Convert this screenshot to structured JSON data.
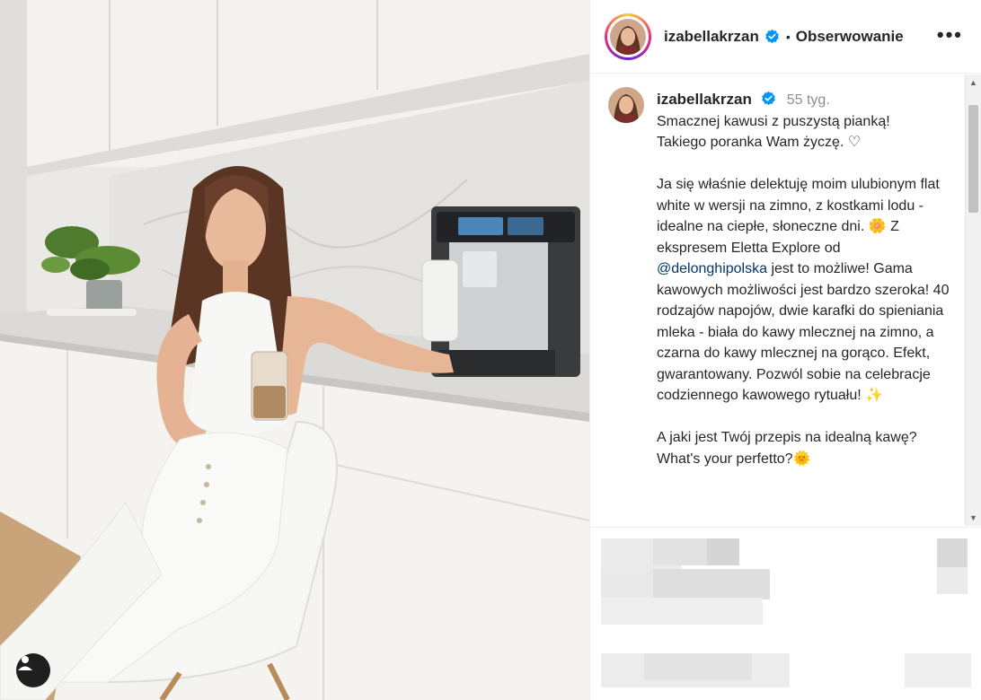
{
  "post": {
    "username": "izabellakrzan",
    "follow_status": "Obserwowanie",
    "separator": "•",
    "more_label": "•••",
    "time_ago": "55 tyg.",
    "caption_lines_1": "Smacznej kawusi z puszystą pianką!\nTakiego poranka Wam życzę. ♡",
    "caption_p2_before": "Ja się właśnie delektuję moim ulubionym flat white w wersji na zimno, z kostkami lodu - idealne na ciepłe, słoneczne dni. 🌼 Z ekspresem Eletta Explore od ",
    "mention": "@delonghipolska",
    "caption_p2_after": " jest to możliwe! Gama kawowych możliwości jest bardzo szeroka! 40 rodzajów napojów, dwie karafki do spieniania mleka - biała do kawy mlecznej na zimno, a czarna do kawy mlecznej na gorąco. Efekt, gwarantowany. Pozwól sobie na celebracje codziennego kawowego rytuału! ✨",
    "caption_p3": "A jaki jest Twój przepis na idealną kawę?\nWhat's your perfetto?🌞"
  },
  "icons": {
    "verified": "verified-badge-icon",
    "tag": "user-tag-icon",
    "more": "more-options-icon"
  },
  "colors": {
    "verified_blue": "#0095f6",
    "mention_blue": "#00376b",
    "time_gray": "#8e8e8e"
  }
}
